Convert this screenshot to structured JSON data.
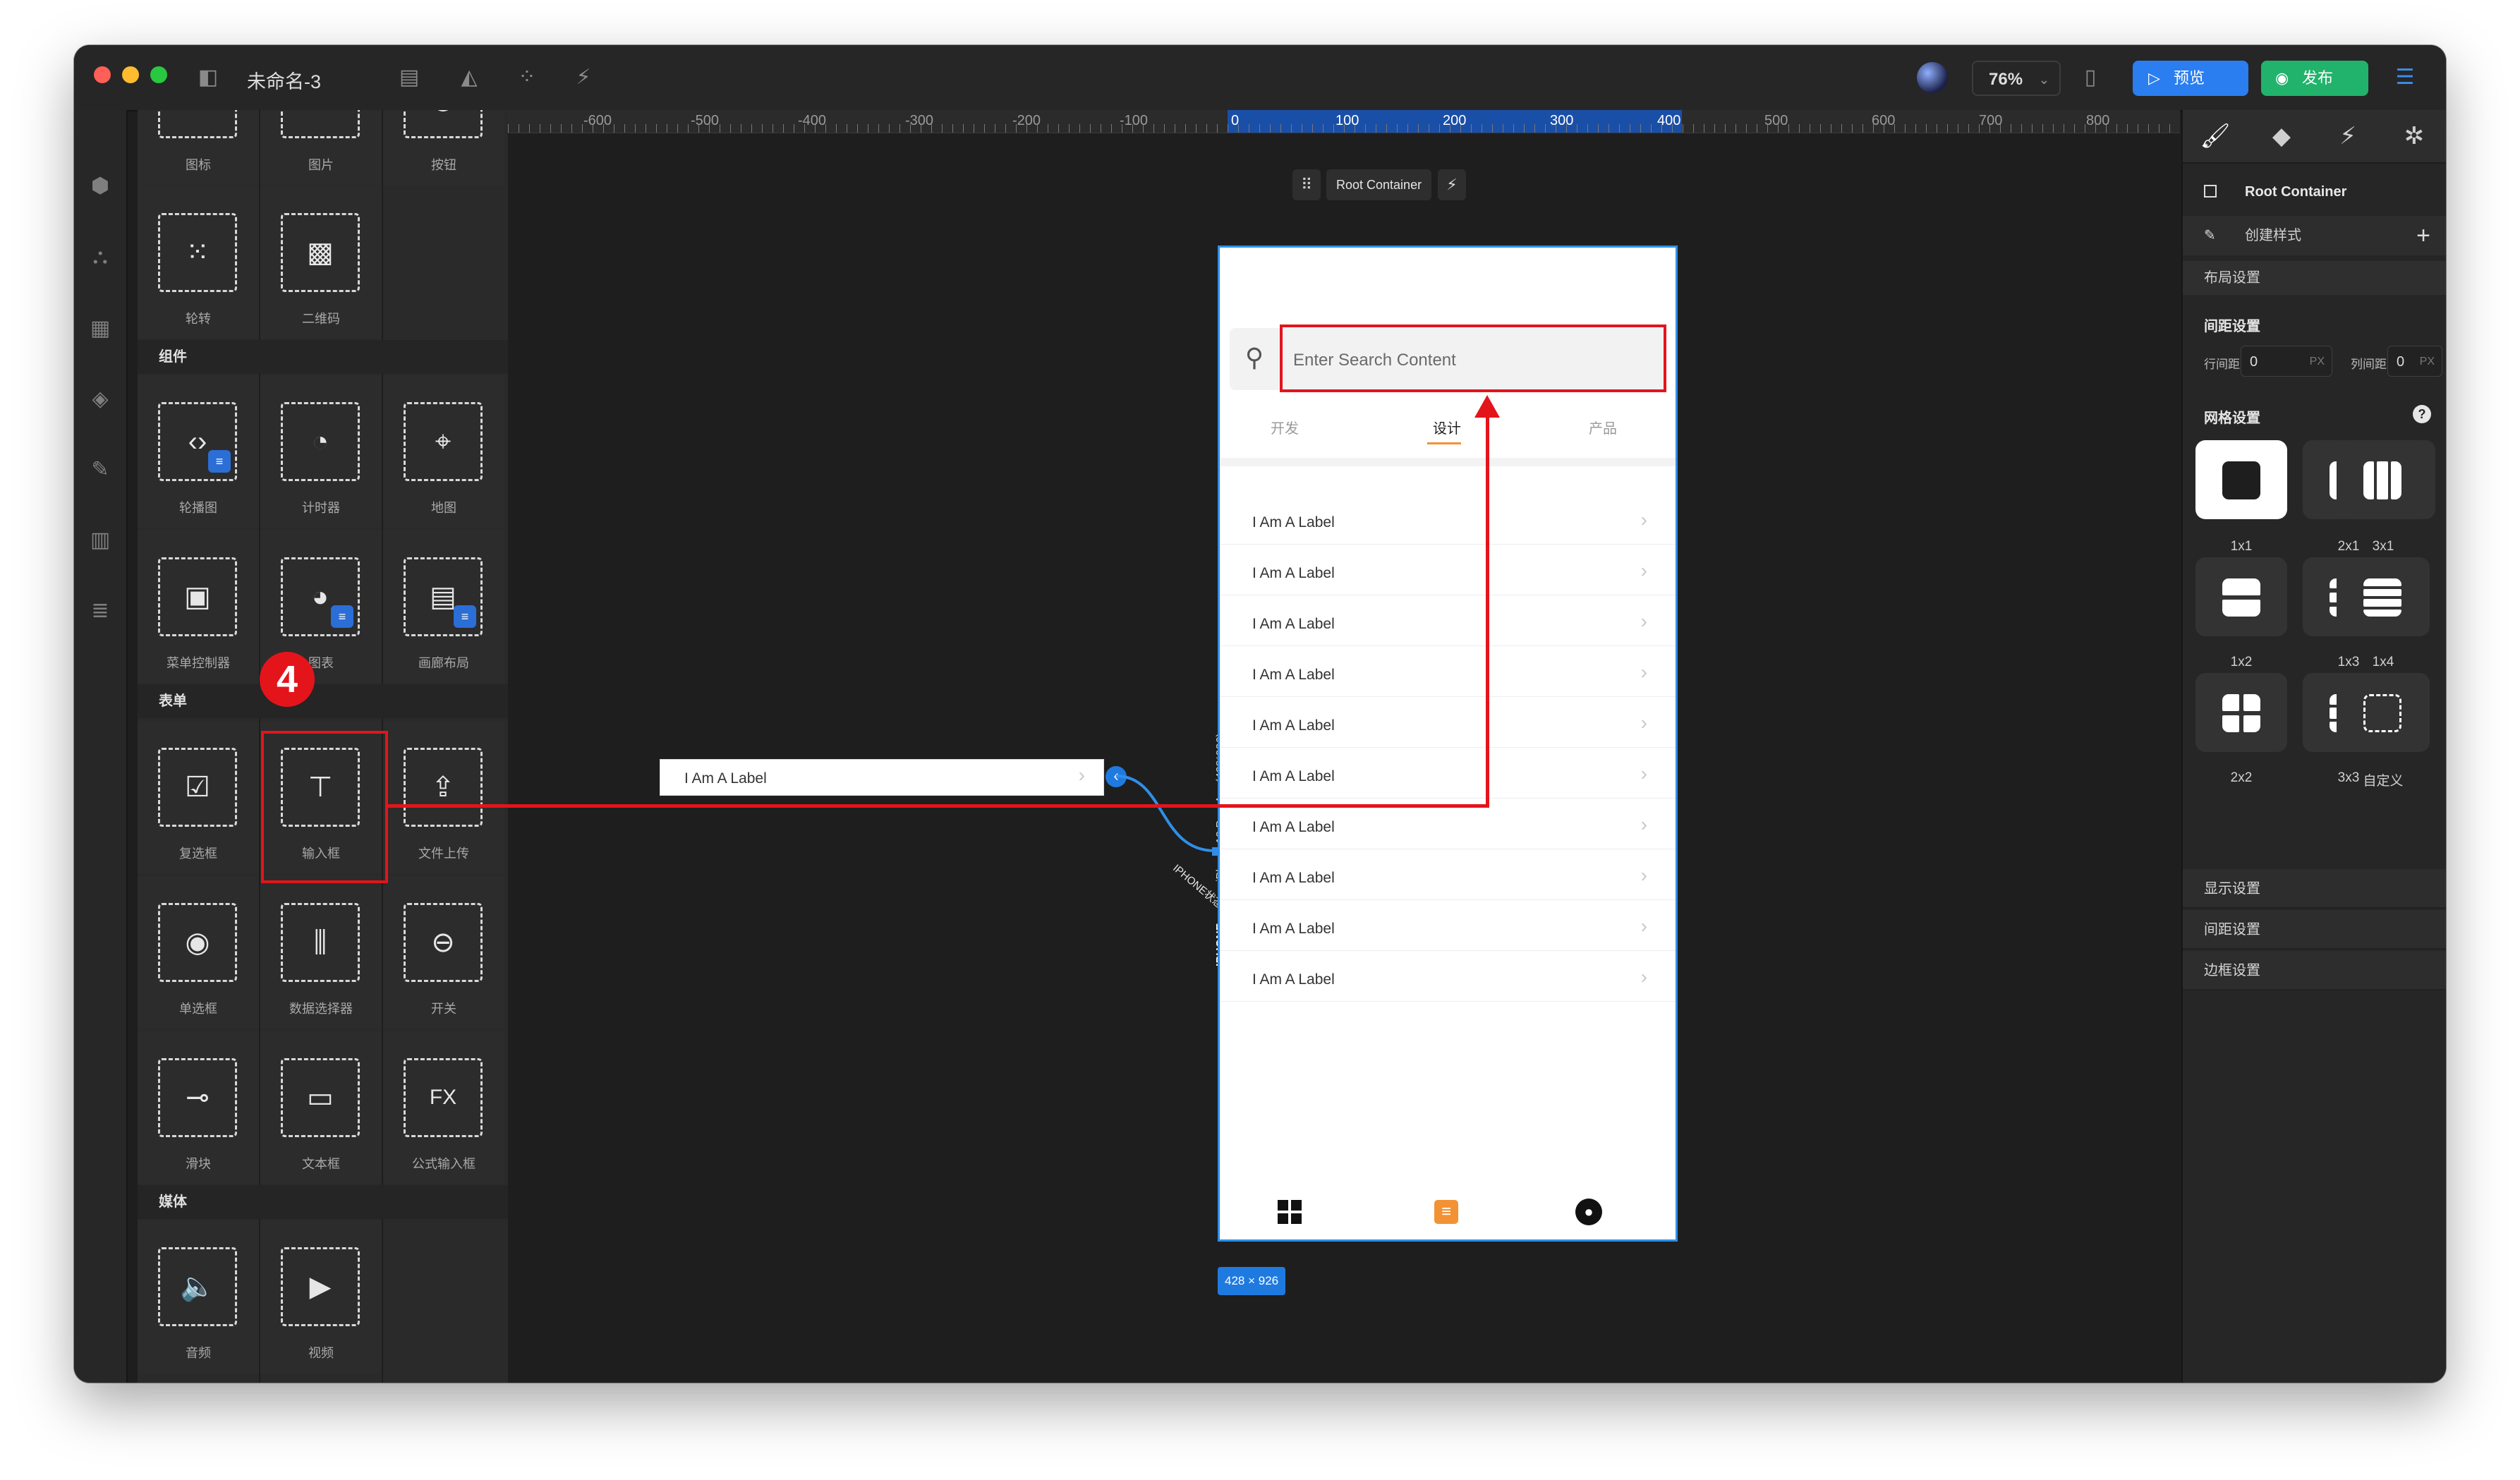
{
  "window": {
    "title": "未命名-3",
    "zoom": "76%",
    "preview_label": "预览",
    "publish_label": "发布"
  },
  "library": {
    "top_labels": [
      "图标",
      "图片",
      "按钮"
    ],
    "row2_labels": [
      "轮转",
      "二维码"
    ],
    "section_components": "组件",
    "components": [
      "轮播图",
      "计时器",
      "地图",
      "菜单控制器",
      "图表",
      "画廊布局"
    ],
    "section_form": "表单",
    "form": [
      "复选框",
      "输入框",
      "文件上传",
      "单选框",
      "数据选择器",
      "开关",
      "滑块",
      "文本框",
      "公式输入框"
    ],
    "section_media": "媒体",
    "media": [
      "音频",
      "视频"
    ]
  },
  "annotation": {
    "step": "4"
  },
  "canvas": {
    "ruler_ticks": [
      "-600",
      "-500",
      "-400",
      "-300",
      "-200",
      "-100",
      "0",
      "100",
      "200",
      "300",
      "400",
      "500",
      "600",
      "700",
      "800"
    ],
    "root_container_label": "Root Container",
    "size_badge": "428 × 926",
    "device_label": "iPhone 12 Pro Max (428*926)",
    "device_short": "IPHONE",
    "detached_row_label": "I Am A Label",
    "connector_label": "IPHONE状态栏"
  },
  "phone": {
    "search_placeholder": "Enter Search Content",
    "tabs": [
      "开发",
      "设计",
      "产品"
    ],
    "list_items": [
      "I Am A Label",
      "I Am A Label",
      "I Am A Label",
      "I Am A Label",
      "I Am A Label",
      "I Am A Label",
      "I Am A Label",
      "I Am A Label",
      "I Am A Label",
      "I Am A Label"
    ]
  },
  "properties": {
    "selected": "Root Container",
    "create_style": "创建样式",
    "layout_section": "布局设置",
    "spacing_section": "间距设置",
    "row_gap_label": "行间距",
    "row_gap_value": "0",
    "col_gap_label": "列间距",
    "col_gap_value": "0",
    "unit": "PX",
    "grid_section": "网格设置",
    "grid_options": [
      "1x1",
      "2x1",
      "3x1",
      "1x2",
      "1x3",
      "1x4",
      "2x2",
      "3x3",
      "自定义"
    ],
    "accordions": [
      "显示设置",
      "间距设置",
      "边框设置"
    ]
  },
  "colors": {
    "accent_blue": "#2f8fe8",
    "publish_green": "#21b36b",
    "annotation_red": "#e4141b",
    "active_tab": "#f39234"
  }
}
